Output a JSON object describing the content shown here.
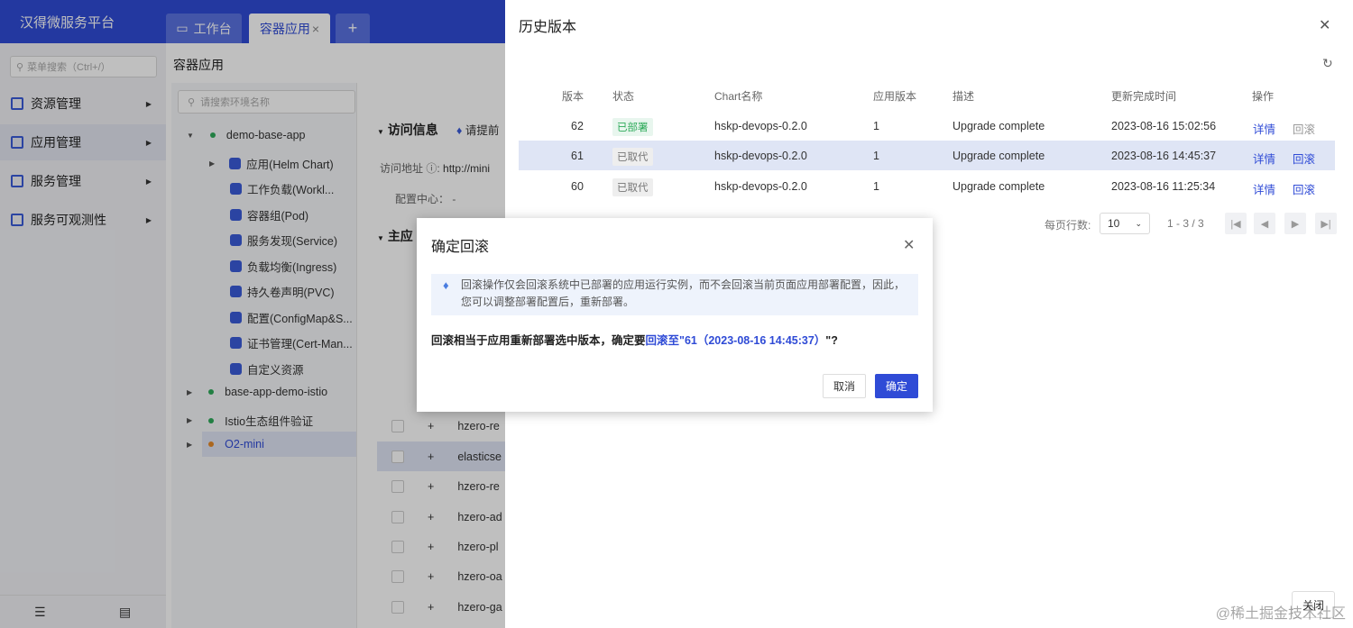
{
  "app": {
    "title": "汉得微服务平台"
  },
  "tabs": [
    {
      "label": "工作台"
    },
    {
      "label": "容器应用",
      "close": "×"
    },
    {
      "label": "+"
    }
  ],
  "sidebar": {
    "search_placeholder": "菜单搜索（Ctrl+/）",
    "items": [
      {
        "label": "资源管理"
      },
      {
        "label": "应用管理"
      },
      {
        "label": "服务管理"
      },
      {
        "label": "服务可观测性"
      }
    ]
  },
  "page": {
    "title": "容器应用"
  },
  "tree": {
    "search_placeholder": "请搜索环境名称",
    "nodes": [
      {
        "label": "demo-base-app"
      },
      {
        "label": "应用(Helm Chart)"
      },
      {
        "label": "工作负载(Workl..."
      },
      {
        "label": "容器组(Pod)"
      },
      {
        "label": "服务发现(Service)"
      },
      {
        "label": "负载均衡(Ingress)"
      },
      {
        "label": "持久卷声明(PVC)"
      },
      {
        "label": "配置(ConfigMap&S..."
      },
      {
        "label": "证书管理(Cert-Man..."
      },
      {
        "label": "自定义资源"
      },
      {
        "label": "base-app-demo-istio"
      },
      {
        "label": "Istio生态组件验证"
      },
      {
        "label": "O2-mini"
      }
    ]
  },
  "content": {
    "section_access": "访问信息",
    "hint": "请提前",
    "access_label": "访问地址",
    "access_value": "http://mini",
    "config_label": "配置中心：",
    "config_value": "-",
    "section_main": "主应",
    "rows": [
      "hzero-re",
      "elasticse",
      "hzero-re",
      "hzero-ad",
      "hzero-pl",
      "hzero-oa",
      "hzero-ga"
    ]
  },
  "drawer": {
    "title": "历史版本",
    "columns": [
      "版本",
      "状态",
      "Chart名称",
      "应用版本",
      "描述",
      "更新完成时间",
      "操作"
    ],
    "rows": [
      {
        "version": "62",
        "status": "已部署",
        "chart": "hskp-devops-0.2.0",
        "app_version": "1",
        "desc": "Upgrade complete",
        "time": "2023-08-16 15:02:56",
        "detail": "详情",
        "rollback": "回滚"
      },
      {
        "version": "61",
        "status": "已取代",
        "chart": "hskp-devops-0.2.0",
        "app_version": "1",
        "desc": "Upgrade complete",
        "time": "2023-08-16 14:45:37",
        "detail": "详情",
        "rollback": "回滚"
      },
      {
        "version": "60",
        "status": "已取代",
        "chart": "hskp-devops-0.2.0",
        "app_version": "1",
        "desc": "Upgrade complete",
        "time": "2023-08-16 11:25:34",
        "detail": "详情",
        "rollback": "回滚"
      }
    ],
    "pagination": {
      "rows_label": "每页行数:",
      "page_size": "10",
      "range": "1 - 3 / 3"
    },
    "close_button": "关闭"
  },
  "dialog": {
    "title": "确定回滚",
    "info_line1": "回滚操作仅会回滚系统中已部署的应用运行实例，而不会回滚当前页面应用部署配置，因此，",
    "info_line2": "您可以调整部署配置后，重新部署。",
    "confirm_prefix": "回滚相当于应用重新部署选中版本，确定要",
    "confirm_highlight": "回滚至\"61（2023-08-16 14:45:37）",
    "confirm_suffix": "\"?",
    "cancel": "取消",
    "ok": "确定"
  },
  "watermark": "@稀土掘金技术社区"
}
